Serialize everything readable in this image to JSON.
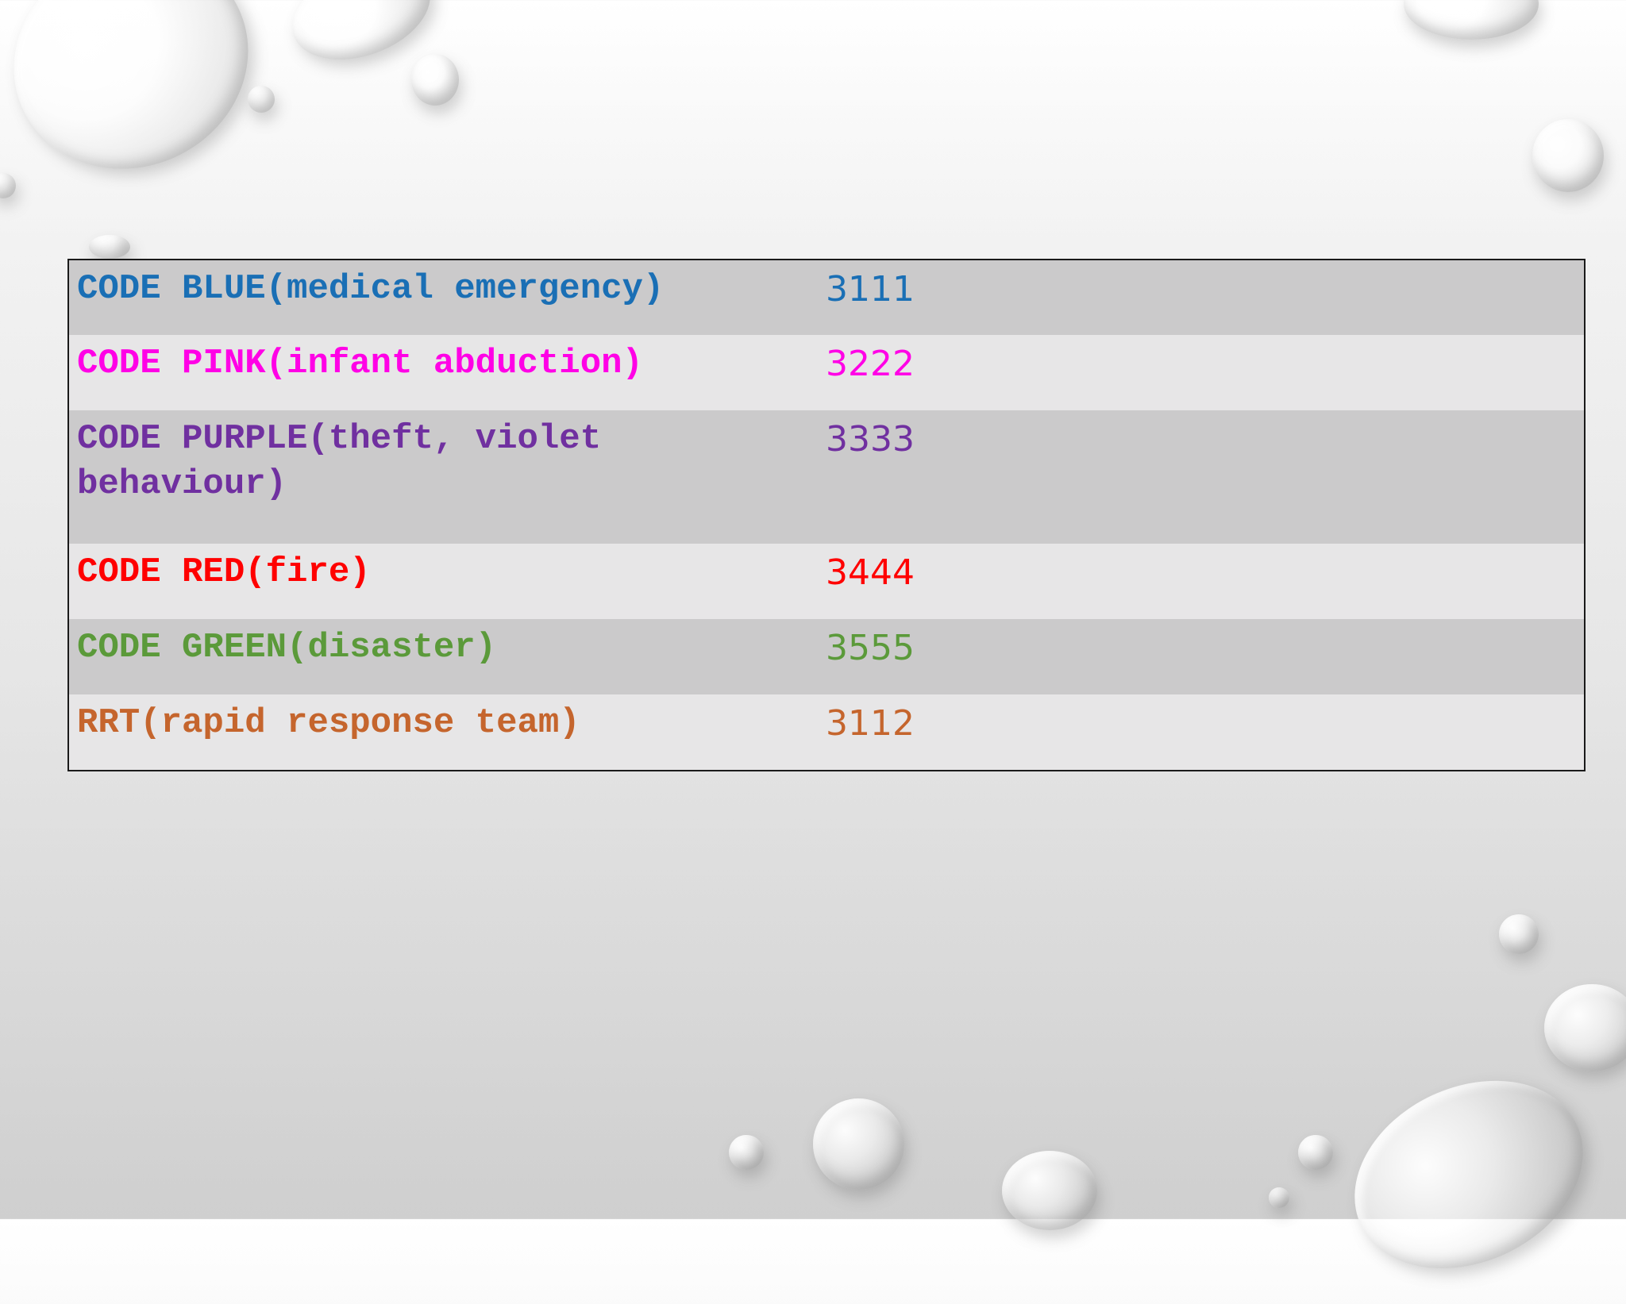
{
  "slide": {
    "rows": [
      {
        "label": "CODE BLUE(medical emergency)",
        "number": "3111",
        "color": "#1a6fb5"
      },
      {
        "label": "CODE PINK(infant abduction)",
        "number": "3222",
        "color": "#ff00e6"
      },
      {
        "label": "CODE PURPLE(theft, violet behaviour)",
        "number": "3333",
        "color": "#7030a0"
      },
      {
        "label": "CODE RED(fire)",
        "number": "3444",
        "color": "#ff0000"
      },
      {
        "label": "CODE GREEN(disaster)",
        "number": "3555",
        "color": "#5b9a3a"
      },
      {
        "label": "RRT(rapid response team)",
        "number": "3112",
        "color": "#c5652d"
      }
    ]
  }
}
